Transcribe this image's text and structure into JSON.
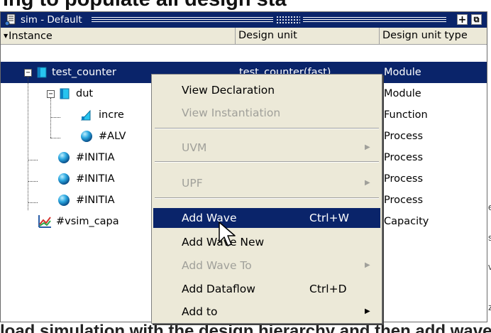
{
  "background": {
    "heading_fragment": "ing to populate all design sta",
    "right_edge_chars": [
      "e",
      "s",
      "v",
      "z"
    ],
    "bottom_fragment": "load simulation with the design hierarchy and then add waves"
  },
  "window": {
    "title": "sim - Default",
    "buttons": [
      {
        "icon": "plus-icon",
        "glyph": "+"
      },
      {
        "icon": "undock-icon",
        "glyph": "⧉"
      }
    ]
  },
  "columns": [
    "Instance",
    "Design unit",
    "Design unit type"
  ],
  "rows": [
    {
      "instance": "test_counter",
      "design_unit": "test_counter(fast)",
      "type": "Module",
      "icon": "module-icon",
      "selected": true,
      "expander": "−"
    },
    {
      "instance": "dut",
      "design_unit": "",
      "type": "Module",
      "icon": "module-icon",
      "selected": false,
      "expander": "−"
    },
    {
      "instance": "incre",
      "design_unit": "",
      "type": "Function",
      "icon": "function-icon",
      "selected": false
    },
    {
      "instance": "#ALV",
      "design_unit": "",
      "type": "Process",
      "icon": "process-icon",
      "selected": false
    },
    {
      "instance": "#INITIA",
      "design_unit": "",
      "type": "Process",
      "icon": "process-icon",
      "selected": false
    },
    {
      "instance": "#INITIA",
      "design_unit": "",
      "type": "Process",
      "icon": "process-icon",
      "selected": false
    },
    {
      "instance": "#INITIA",
      "design_unit": "",
      "type": "Process",
      "icon": "process-icon",
      "selected": false
    },
    {
      "instance": "#vsim_capa",
      "design_unit": "",
      "type": "Capacity",
      "icon": "capacity-icon",
      "selected": false
    }
  ],
  "context_menu": {
    "items": [
      {
        "label": "View Declaration",
        "shortcut": "",
        "enabled": true,
        "submenu": false
      },
      {
        "label": "View Instantiation",
        "shortcut": "",
        "enabled": false,
        "submenu": false
      },
      {
        "label": "UVM",
        "shortcut": "",
        "enabled": false,
        "submenu": true
      },
      {
        "label": "UPF",
        "shortcut": "",
        "enabled": false,
        "submenu": true
      },
      {
        "label": "Add Wave",
        "shortcut": "Ctrl+W",
        "enabled": true,
        "submenu": false,
        "highlighted": true
      },
      {
        "label": "Add Wave New",
        "shortcut": "",
        "enabled": true,
        "submenu": false
      },
      {
        "label": "Add Wave To",
        "shortcut": "",
        "enabled": false,
        "submenu": true
      },
      {
        "label": "Add Dataflow",
        "shortcut": "Ctrl+D",
        "enabled": true,
        "submenu": false
      },
      {
        "label": "Add to",
        "shortcut": "",
        "enabled": true,
        "submenu": true
      }
    ],
    "submenu_arrow": "▶"
  },
  "colors": {
    "selection": "#0a246a",
    "menu_bg": "#ece9d8",
    "disabled_text": "#a0a09a"
  }
}
